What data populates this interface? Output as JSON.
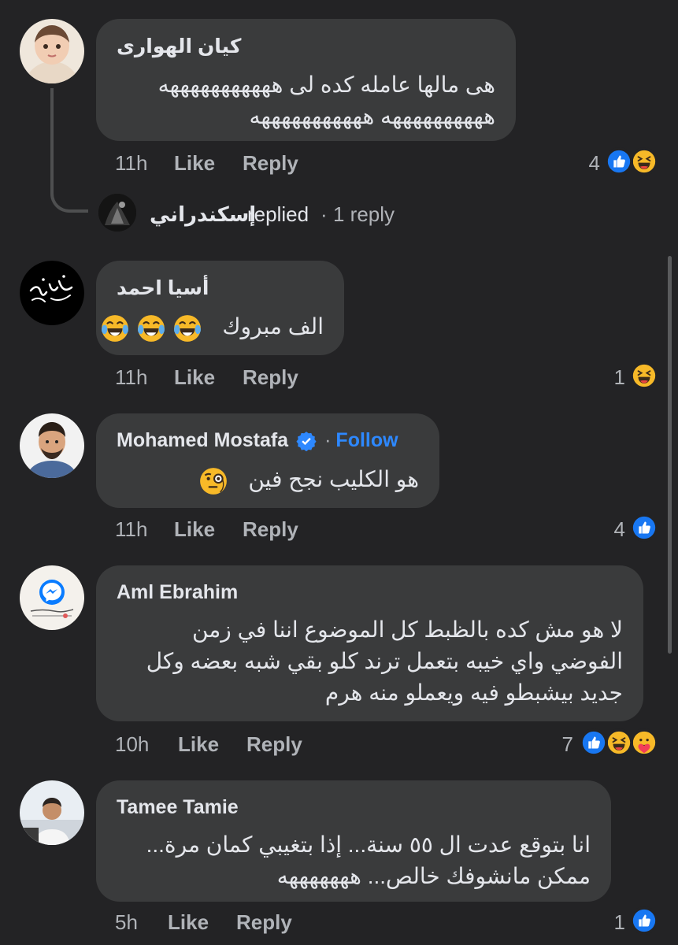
{
  "comments": [
    {
      "name": "كيان الهوارى",
      "lines": [
        "هى مالها عامله كده لى هههههههههههه",
        "ههههههههههه هههههههههههه"
      ],
      "time": "11h",
      "like": "Like",
      "reply": "Reply",
      "reaction_count": "4",
      "reactions": [
        "like-icon",
        "haha-icon"
      ]
    },
    {
      "name": "أسيا احمد",
      "lines": [
        "الف مبروك"
      ],
      "emojis": [
        "tears-of-joy-emoji",
        "tears-of-joy-emoji",
        "tears-of-joy-emoji"
      ],
      "time": "11h",
      "like": "Like",
      "reply": "Reply",
      "reaction_count": "1",
      "reactions": [
        "haha-icon"
      ]
    },
    {
      "name": "Mohamed Mostafa",
      "verified": true,
      "separator": "·",
      "follow": "Follow",
      "lines": [
        "هو الكليب نجح فين"
      ],
      "emojis": [
        "monocle-face-emoji"
      ],
      "time": "11h",
      "like": "Like",
      "reply": "Reply",
      "reaction_count": "4",
      "reactions": [
        "like-icon"
      ]
    },
    {
      "name": "Aml Ebrahim",
      "lines": [
        "لا هو مش كده بالظبط كل الموضوع اننا في زمن",
        "الفوضي واي خيبه بتعمل ترند كلو بقي شبه بعضه وكل",
        "جديد بيشبطو فيه ويعملو منه هرم"
      ],
      "time": "10h",
      "like": "Like",
      "reply": "Reply",
      "reaction_count": "7",
      "reactions": [
        "like-icon",
        "haha-icon",
        "care-icon"
      ]
    },
    {
      "name": "Tamee Tamie",
      "lines": [
        "انا بتوقع عدت ال ٥٥ سنة... إذا بتغيبي كمان مرة...",
        "ممكن مانشوفك خالص... هههههههه"
      ],
      "time": "5h",
      "like": "Like",
      "reply": "Reply",
      "reaction_count": "1",
      "reactions": [
        "like-icon"
      ]
    }
  ],
  "replies_summary": {
    "name": "إسكندراني",
    "action": "replied",
    "separator": "·",
    "count": "1 reply"
  },
  "colors": {
    "background": "#232325",
    "bubble": "#3a3b3c",
    "text": "#e4e6eb",
    "meta": "#b0b3b8",
    "link": "#2d88ff",
    "like_blue": "#1877f2",
    "haha_yellow": "#f7b928"
  }
}
